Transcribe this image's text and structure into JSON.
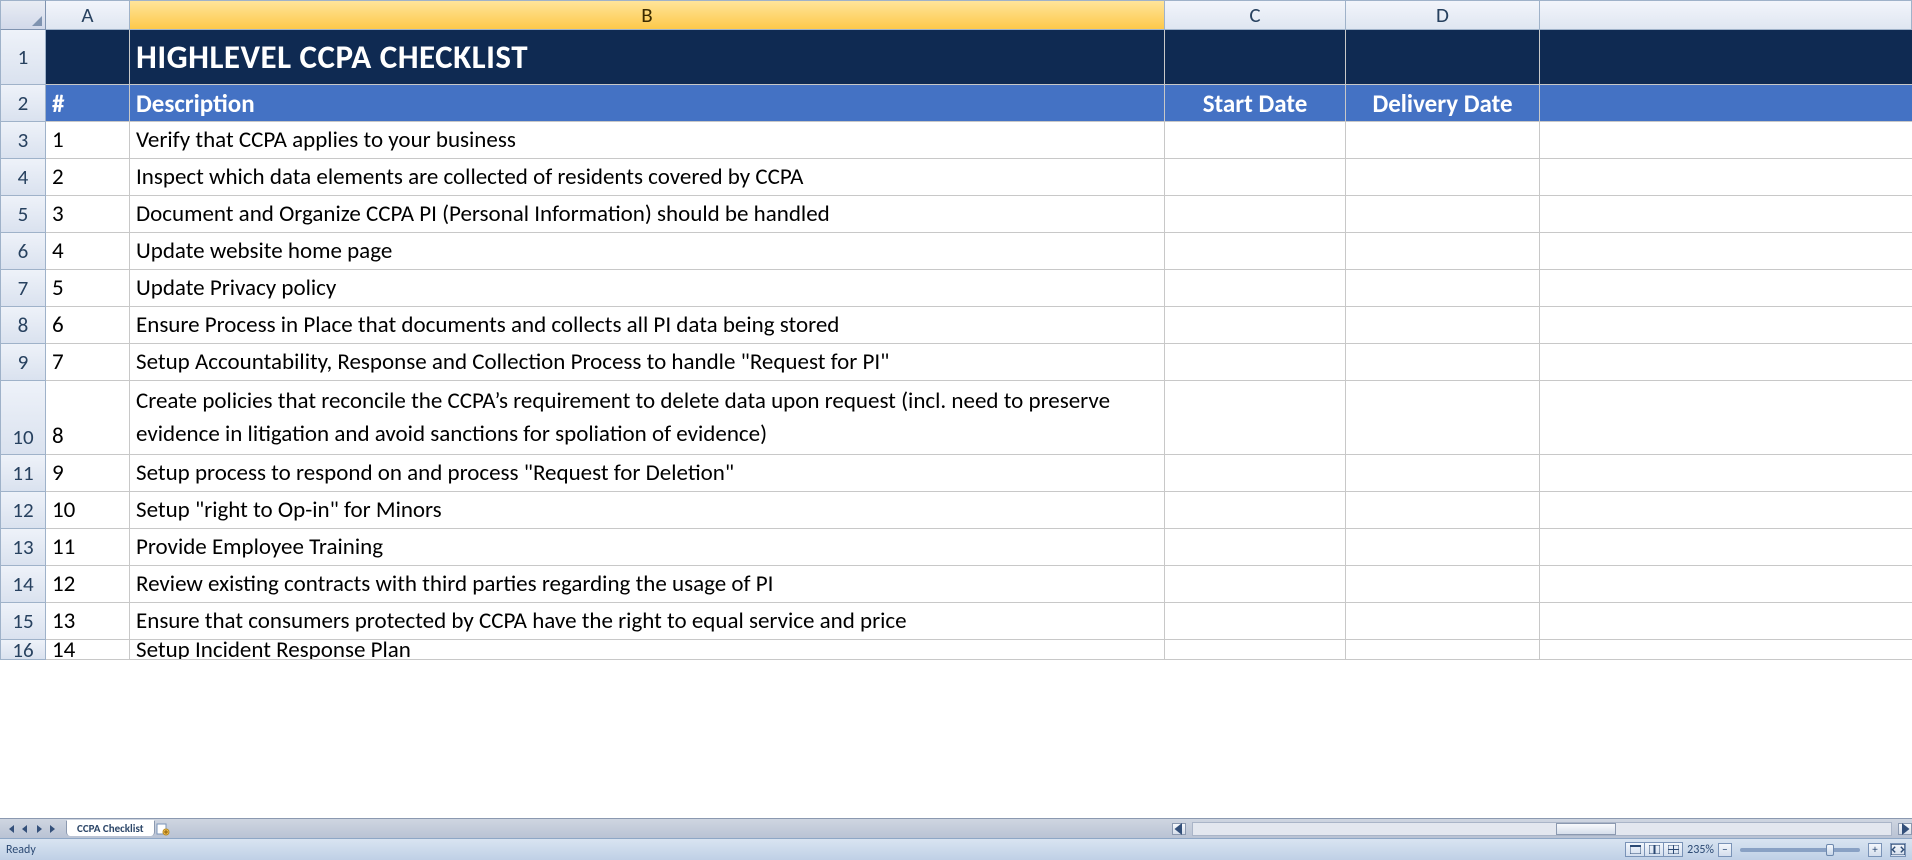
{
  "columns": {
    "A": "A",
    "B": "B",
    "C": "C",
    "D": "D"
  },
  "row_numbers": [
    "1",
    "2",
    "3",
    "4",
    "5",
    "6",
    "7",
    "8",
    "9",
    "10",
    "11",
    "12",
    "13",
    "14",
    "15",
    "16"
  ],
  "title": "HIGHLEVEL CCPA CHECKLIST",
  "headers": {
    "num": "#",
    "description": "Description",
    "start_date": "Start Date",
    "delivery_date": "Delivery Date"
  },
  "rows": [
    {
      "n": "1",
      "desc": "Verify that CCPA applies to your business",
      "start": "",
      "delivery": ""
    },
    {
      "n": "2",
      "desc": "Inspect which data elements are collected of residents covered by CCPA",
      "start": "",
      "delivery": ""
    },
    {
      "n": "3",
      "desc": "Document and Organize CCPA PI (Personal Information) should be handled",
      "start": "",
      "delivery": ""
    },
    {
      "n": "4",
      "desc": "Update website home page",
      "start": "",
      "delivery": ""
    },
    {
      "n": "5",
      "desc": "Update Privacy policy",
      "start": "",
      "delivery": ""
    },
    {
      "n": "6",
      "desc": "Ensure Process in Place that documents and collects all PI data being stored",
      "start": "",
      "delivery": ""
    },
    {
      "n": "7",
      "desc": "Setup Accountability, Response and Collection Process to handle \"Request for PI\"",
      "start": "",
      "delivery": ""
    },
    {
      "n": "8",
      "desc": "Create policies that reconcile the CCPA’s requirement to delete data upon request (incl. need to preserve evidence in litigation and avoid sanctions for spoliation of evidence)",
      "start": "",
      "delivery": ""
    },
    {
      "n": "9",
      "desc": "Setup process to respond on and process \"Request for Deletion\"",
      "start": "",
      "delivery": ""
    },
    {
      "n": "10",
      "desc": "Setup \"right to Op-in\" for Minors",
      "start": "",
      "delivery": ""
    },
    {
      "n": "11",
      "desc": "Provide Employee Training",
      "start": "",
      "delivery": ""
    },
    {
      "n": "12",
      "desc": "Review existing contracts with third parties regarding the usage of PI",
      "start": "",
      "delivery": ""
    },
    {
      "n": "13",
      "desc": "Ensure that consumers protected by CCPA have the right to equal service and price",
      "start": "",
      "delivery": ""
    },
    {
      "n": "14",
      "desc": "Setup Incident Response Plan",
      "start": "",
      "delivery": ""
    }
  ],
  "sheet_tab": "CCPA Checklist",
  "status": {
    "ready": "Ready",
    "zoom": "235%"
  }
}
